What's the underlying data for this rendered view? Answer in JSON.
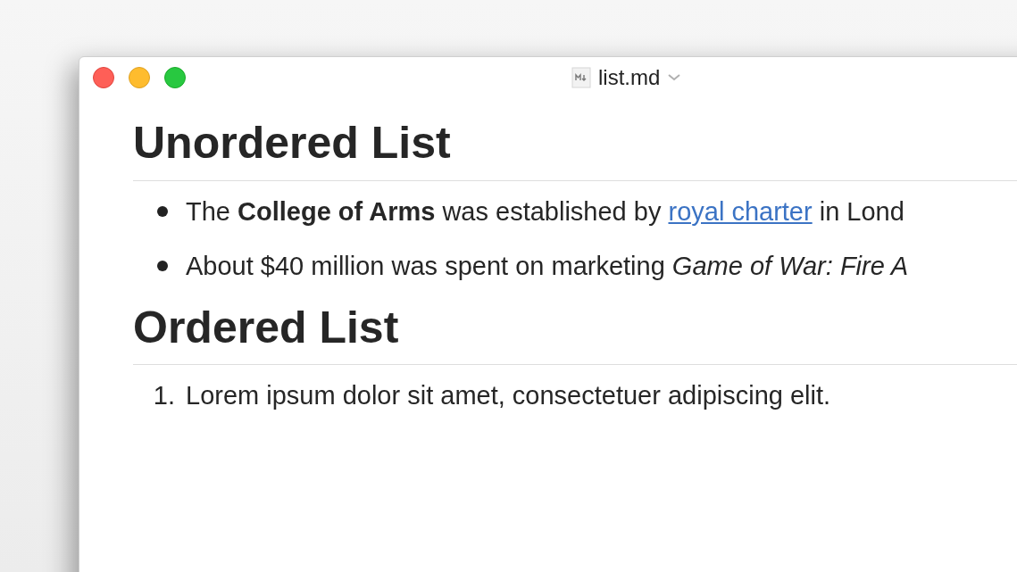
{
  "window": {
    "title": "list.md"
  },
  "sections": [
    {
      "heading": "Unordered List",
      "list": {
        "kind": "bullet",
        "items": [
          {
            "marker": "",
            "segments": [
              {
                "kind": "text",
                "text": "The "
              },
              {
                "kind": "bold",
                "text": "College of Arms"
              },
              {
                "kind": "text",
                "text": " was established by "
              },
              {
                "kind": "link",
                "text": "royal charter"
              },
              {
                "kind": "text",
                "text": " in Lond"
              }
            ]
          },
          {
            "marker": "",
            "segments": [
              {
                "kind": "text",
                "text": "About $40 million was spent on marketing "
              },
              {
                "kind": "italic",
                "text": "Game of War: Fire A"
              }
            ]
          }
        ]
      }
    },
    {
      "heading": "Ordered List",
      "list": {
        "kind": "number",
        "items": [
          {
            "marker": "1.",
            "segments": [
              {
                "kind": "text",
                "text": "Lorem ipsum dolor sit amet, consectetuer adipiscing elit."
              }
            ]
          }
        ]
      }
    }
  ]
}
